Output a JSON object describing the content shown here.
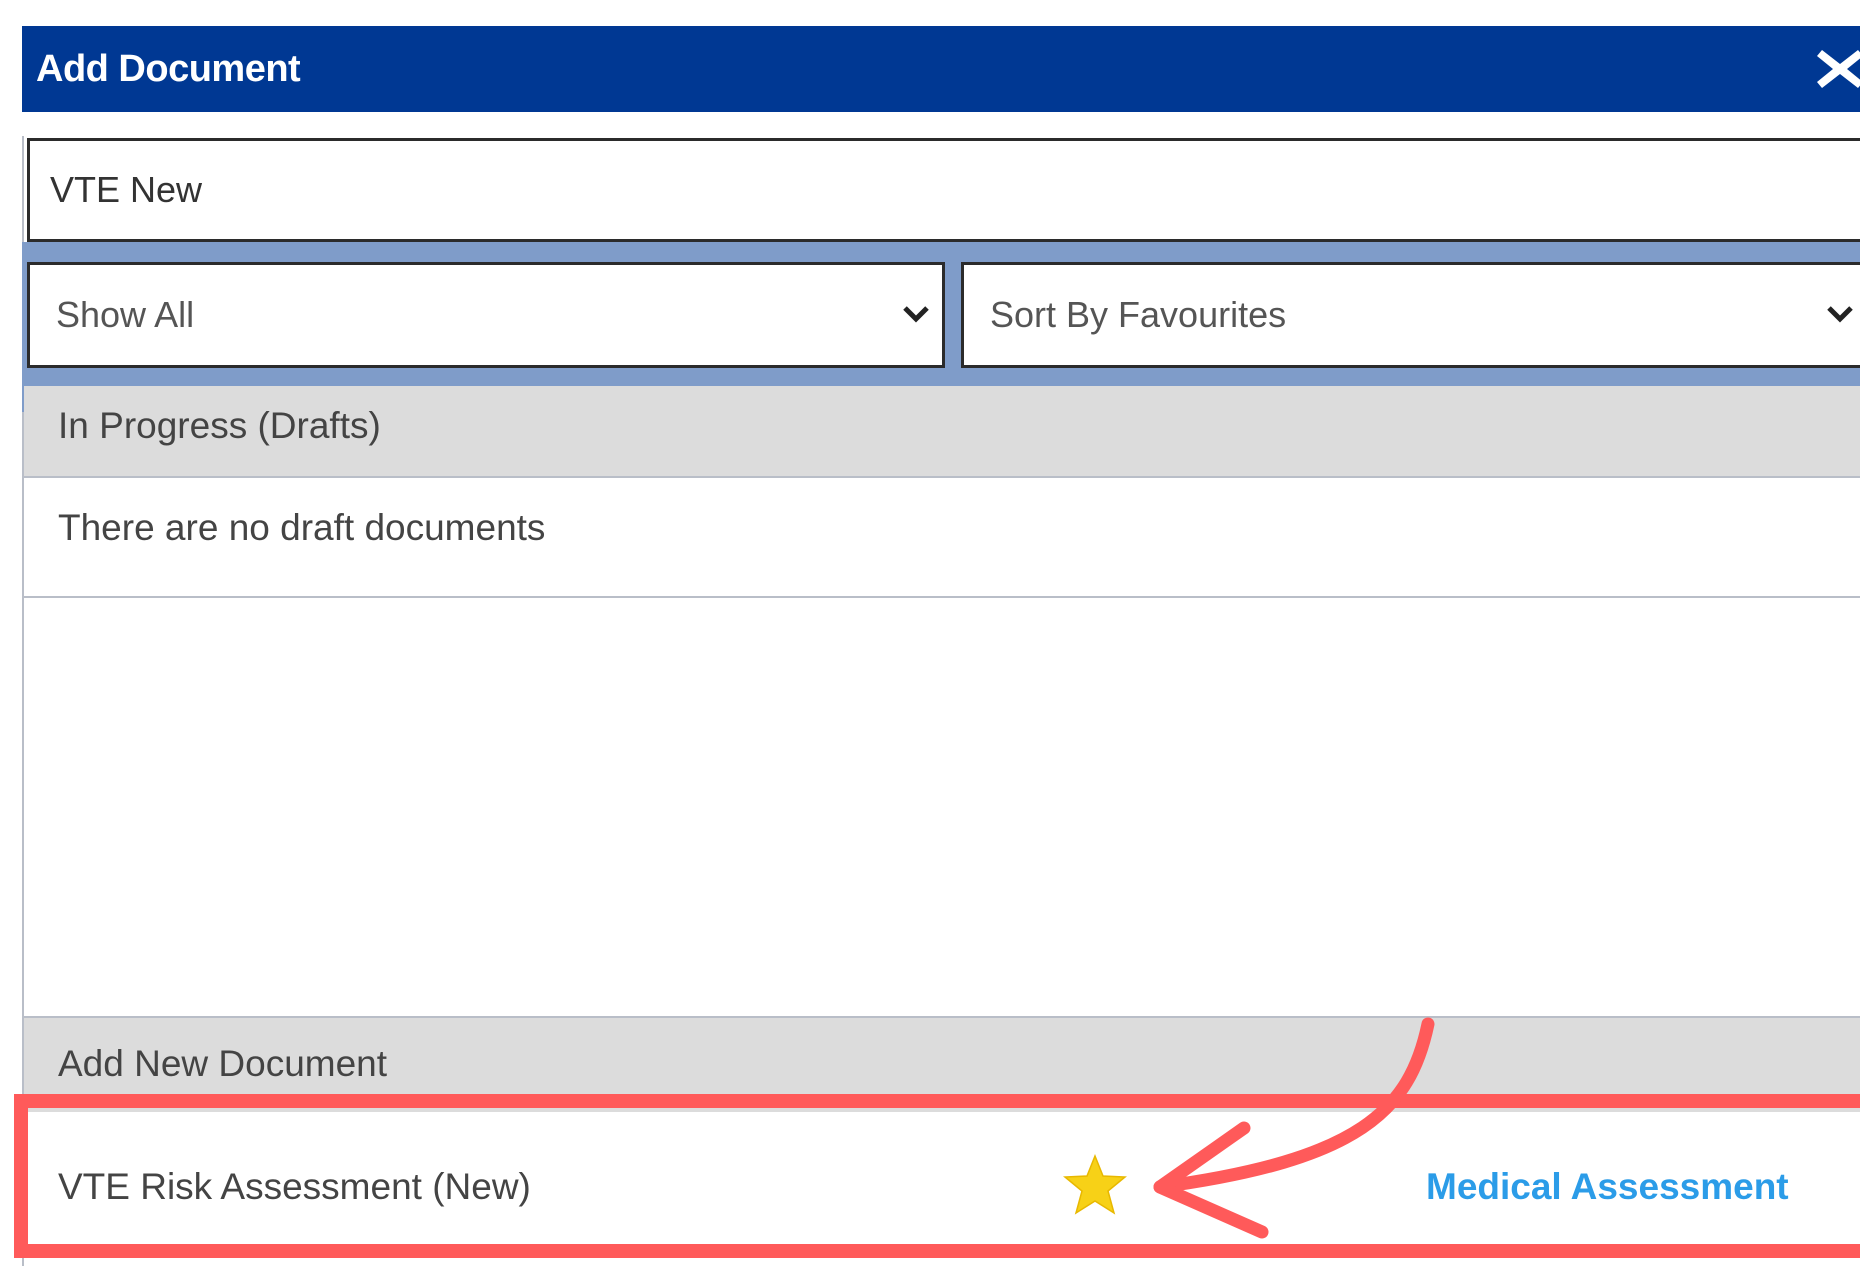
{
  "dialog": {
    "title": "Add Document",
    "close_icon": "close-icon"
  },
  "search": {
    "value": "VTE New"
  },
  "filters": {
    "show_filter": {
      "selected": "Show All",
      "icon": "chevron-down-icon"
    },
    "sort_filter": {
      "selected": "Sort By Favourites",
      "icon": "chevron-down-icon"
    }
  },
  "drafts_section": {
    "header": "In Progress (Drafts)",
    "empty_message": "There are no draft documents"
  },
  "new_document_section": {
    "header": "Add New Document",
    "items": [
      {
        "name": "VTE Risk Assessment (New)",
        "favourite": true,
        "favourite_icon": "star-icon",
        "category": "Medical Assessment"
      }
    ]
  },
  "annotation": {
    "highlight_color": "#ff5a5a",
    "arrow_icon": "curved-arrow-icon"
  },
  "colors": {
    "titlebar": "#003893",
    "filter_bar": "#7f9cc9",
    "section_header": "#dcdcdc",
    "link": "#2b9ce8",
    "star": "#f7d117"
  }
}
